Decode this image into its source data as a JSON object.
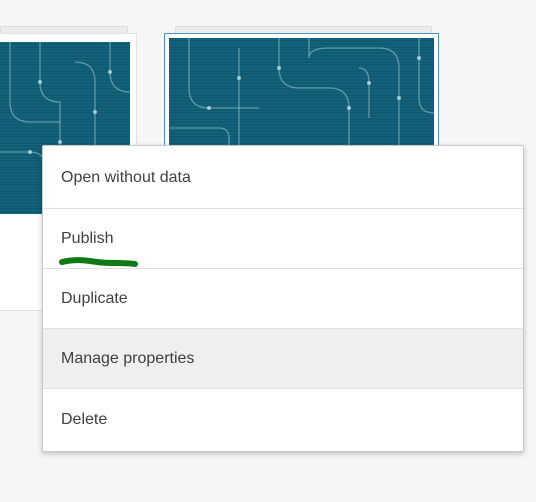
{
  "context_menu": {
    "items": [
      {
        "id": "open-without-data",
        "label": "Open without data"
      },
      {
        "id": "publish",
        "label": "Publish"
      },
      {
        "id": "duplicate",
        "label": "Duplicate"
      },
      {
        "id": "manage-properties",
        "label": "Manage properties",
        "hovered": true
      },
      {
        "id": "delete",
        "label": "Delete"
      }
    ]
  },
  "colors": {
    "thumbnail": "#0d5c73",
    "selected_outline": "#4a90c8",
    "menu_hover": "#efefef",
    "annotation": "#0f7a14"
  },
  "icons": [
    "circuit-pattern-thumbnail"
  ]
}
